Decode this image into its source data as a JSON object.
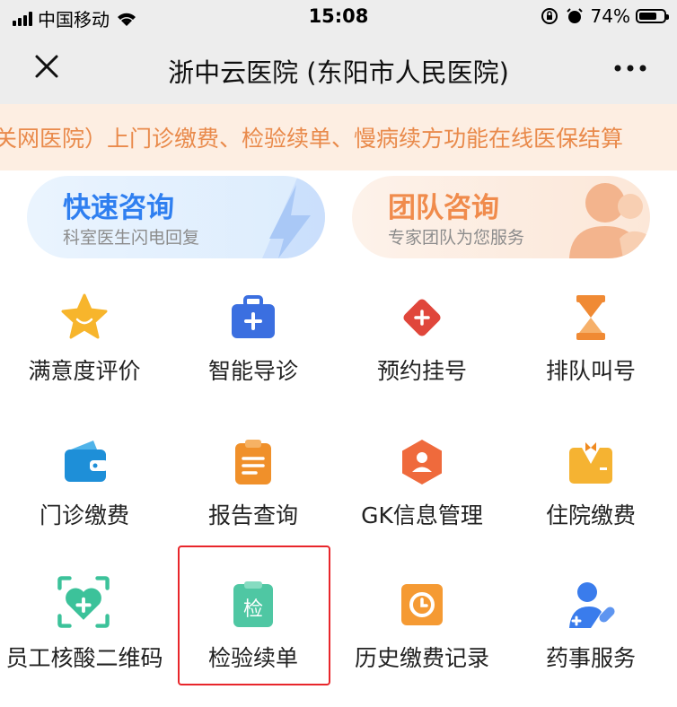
{
  "status_bar": {
    "carrier": "中国移动",
    "time": "15:08",
    "battery_percent": "74%",
    "battery_level": 0.74,
    "icons": [
      "signal-icon",
      "wifi-icon",
      "rotation-lock-icon",
      "alarm-icon",
      "battery-icon"
    ]
  },
  "nav": {
    "title": "浙中云医院 (东阳市人民医院)",
    "close_icon": "close-icon",
    "more_icon": "more-icon"
  },
  "notice": {
    "text": "关网医院）上门诊缴费、检验续单、慢病续方功能在线医保结算"
  },
  "banners": [
    {
      "title": "快速咨询",
      "subtitle": "科室医生闪电回复",
      "icon": "lightning-icon"
    },
    {
      "title": "团队咨询",
      "subtitle": "专家团队为您服务",
      "icon": "team-icon"
    }
  ],
  "grid": [
    {
      "label": "满意度评价",
      "icon": "star-icon"
    },
    {
      "label": "智能导诊",
      "icon": "medical-kit-icon"
    },
    {
      "label": "预约挂号",
      "icon": "diamond-plus-icon"
    },
    {
      "label": "排队叫号",
      "icon": "hourglass-icon"
    },
    {
      "label": "门诊缴费",
      "icon": "wallet-icon"
    },
    {
      "label": "报告查询",
      "icon": "clipboard-icon"
    },
    {
      "label": "GK信息管理",
      "icon": "user-hexagon-icon"
    },
    {
      "label": "住院缴费",
      "icon": "staff-uniform-icon"
    },
    {
      "label": "员工核酸二维码",
      "icon": "heart-scan-icon"
    },
    {
      "label": "检验续单",
      "icon": "lab-clipboard-icon",
      "icon_text": "检"
    },
    {
      "label": "历史缴费记录",
      "icon": "clock-icon"
    },
    {
      "label": "药事服务",
      "icon": "pharmacist-icon"
    }
  ],
  "colors": {
    "nav_bg": "#ededed",
    "notice_bg": "#fdeee2",
    "notice_text": "#e98a4b",
    "fast_accent": "#2f7ff0",
    "team_accent": "#f08b4c",
    "highlight": "#e8262b"
  }
}
